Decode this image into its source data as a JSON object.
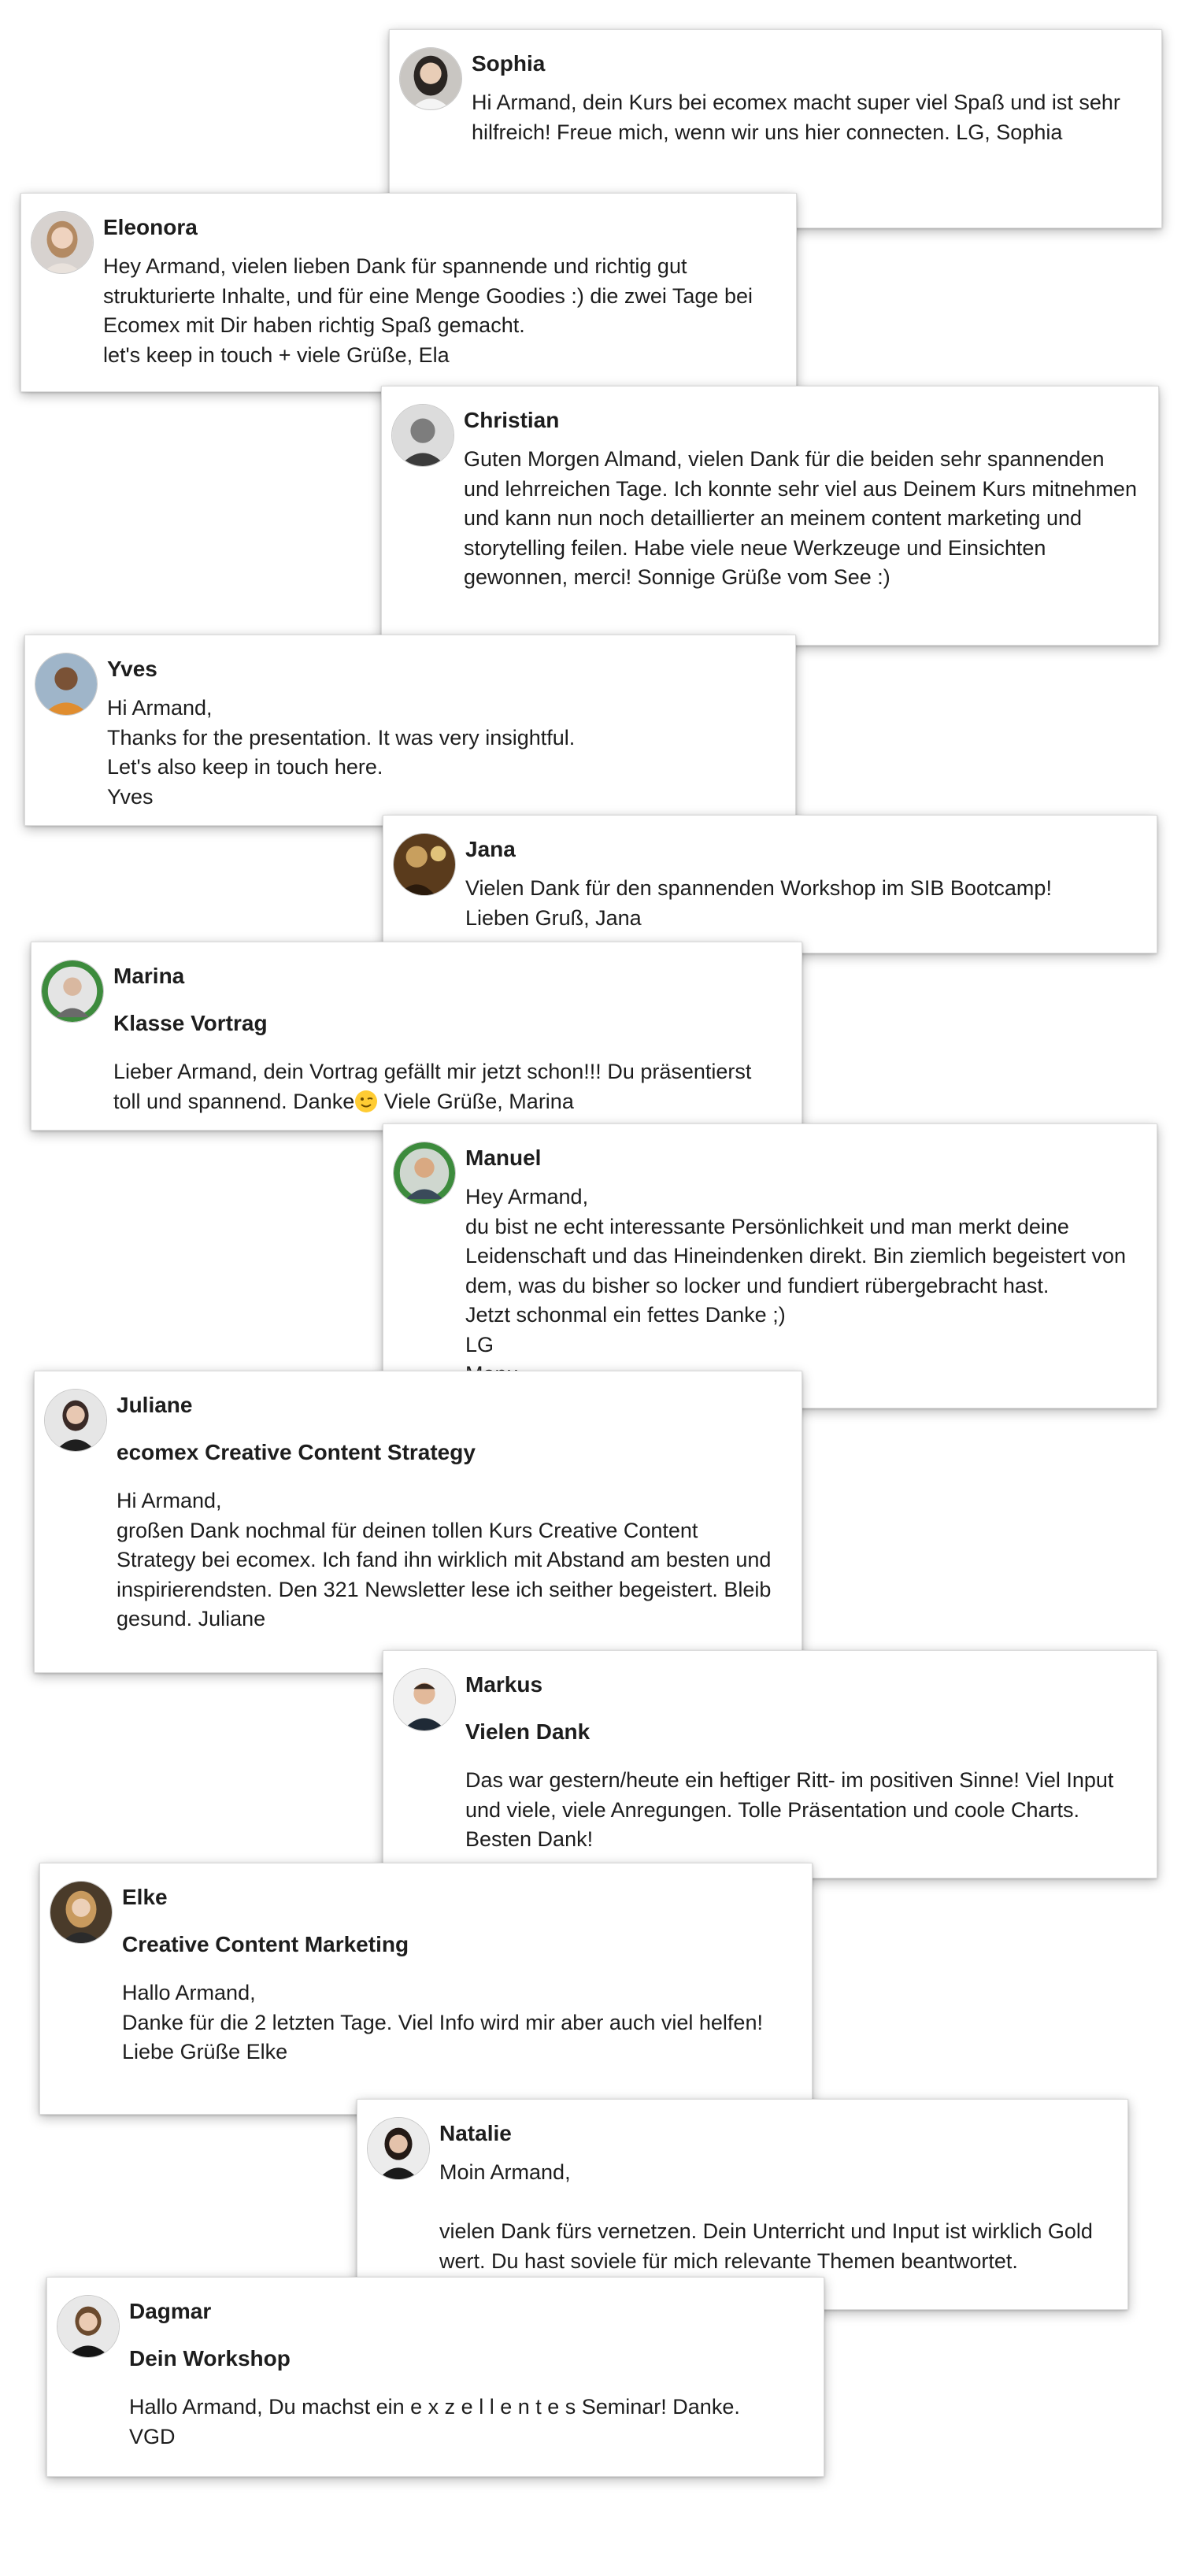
{
  "messages": [
    {
      "name": "Sophia",
      "subject": "",
      "body": "Hi Armand, dein Kurs bei ecomex macht super viel Spaß und ist sehr hilfreich! Freue mich, wenn wir uns hier connecten. LG, Sophia"
    },
    {
      "name": "Eleonora",
      "subject": "",
      "body": "Hey Armand, vielen lieben Dank für spannende und richtig gut strukturierte Inhalte, und für eine Menge Goodies :) die zwei Tage bei Ecomex mit Dir haben richtig Spaß gemacht.\nlet's keep in touch + viele Grüße, Ela"
    },
    {
      "name": "Christian",
      "subject": "",
      "body": "Guten Morgen Almand, vielen Dank für die beiden sehr spannenden und lehrreichen Tage. Ich konnte sehr viel aus Deinem Kurs mitnehmen und kann nun noch detaillierter an meinem content marketing und storytelling feilen. Habe viele neue Werkzeuge und Einsichten gewonnen, merci! Sonnige Grüße vom See :)"
    },
    {
      "name": "Yves",
      "subject": "",
      "body": "Hi Armand,\nThanks for the presentation. It was very insightful.\nLet's also keep in touch here.\nYves"
    },
    {
      "name": "Jana",
      "subject": "",
      "body": "Vielen Dank für den spannenden Workshop im SIB Bootcamp!\nLieben Gruß, Jana"
    },
    {
      "name": "Marina",
      "subject": "Klasse Vortrag",
      "body": "Lieber Armand, dein Vortrag gefällt mir jetzt schon!!! Du präsentierst toll und spannend. Danke",
      "body_after_emoji": " Viele Grüße, Marina",
      "emoji": "winking-face-emoji"
    },
    {
      "name": "Manuel",
      "subject": "",
      "body": "Hey Armand,\ndu bist ne echt interessante Persönlichkeit und man merkt deine Leidenschaft und das Hineindenken direkt. Bin ziemlich begeistert von dem, was du bisher so locker und fundiert rübergebracht hast.\nJetzt schonmal ein fettes Danke ;)\nLG\nManu"
    },
    {
      "name": "Juliane",
      "subject": "ecomex Creative Content Strategy",
      "body": "Hi Armand,\ngroßen Dank nochmal für deinen tollen Kurs Creative Content Strategy bei ecomex. Ich fand ihn wirklich mit Abstand am besten und inspirierendsten. Den 321 Newsletter lese ich seither begeistert. Bleib gesund. Juliane"
    },
    {
      "name": "Markus",
      "subject": "Vielen Dank",
      "body": "Das war gestern/heute ein heftiger Ritt- im positiven Sinne! Viel Input und viele, viele Anregungen. Tolle Präsentation und coole Charts. Besten Dank!"
    },
    {
      "name": "Elke",
      "subject": "Creative Content Marketing",
      "body": "Hallo Armand,\nDanke für die 2 letzten Tage. Viel Info wird mir aber auch viel helfen!\nLiebe Grüße Elke"
    },
    {
      "name": "Natalie",
      "subject": "",
      "body": "Moin Armand,\n\nvielen Dank fürs vernetzen. Dein Unterricht und Input ist wirklich Gold wert. Du hast soviele für mich relevante Themen beantwortet."
    },
    {
      "name": "Dagmar",
      "subject": "Dein Workshop",
      "body": "Hallo Armand, Du machst ein e x z e l l e n t e s Seminar! Danke.\nVGD"
    }
  ]
}
